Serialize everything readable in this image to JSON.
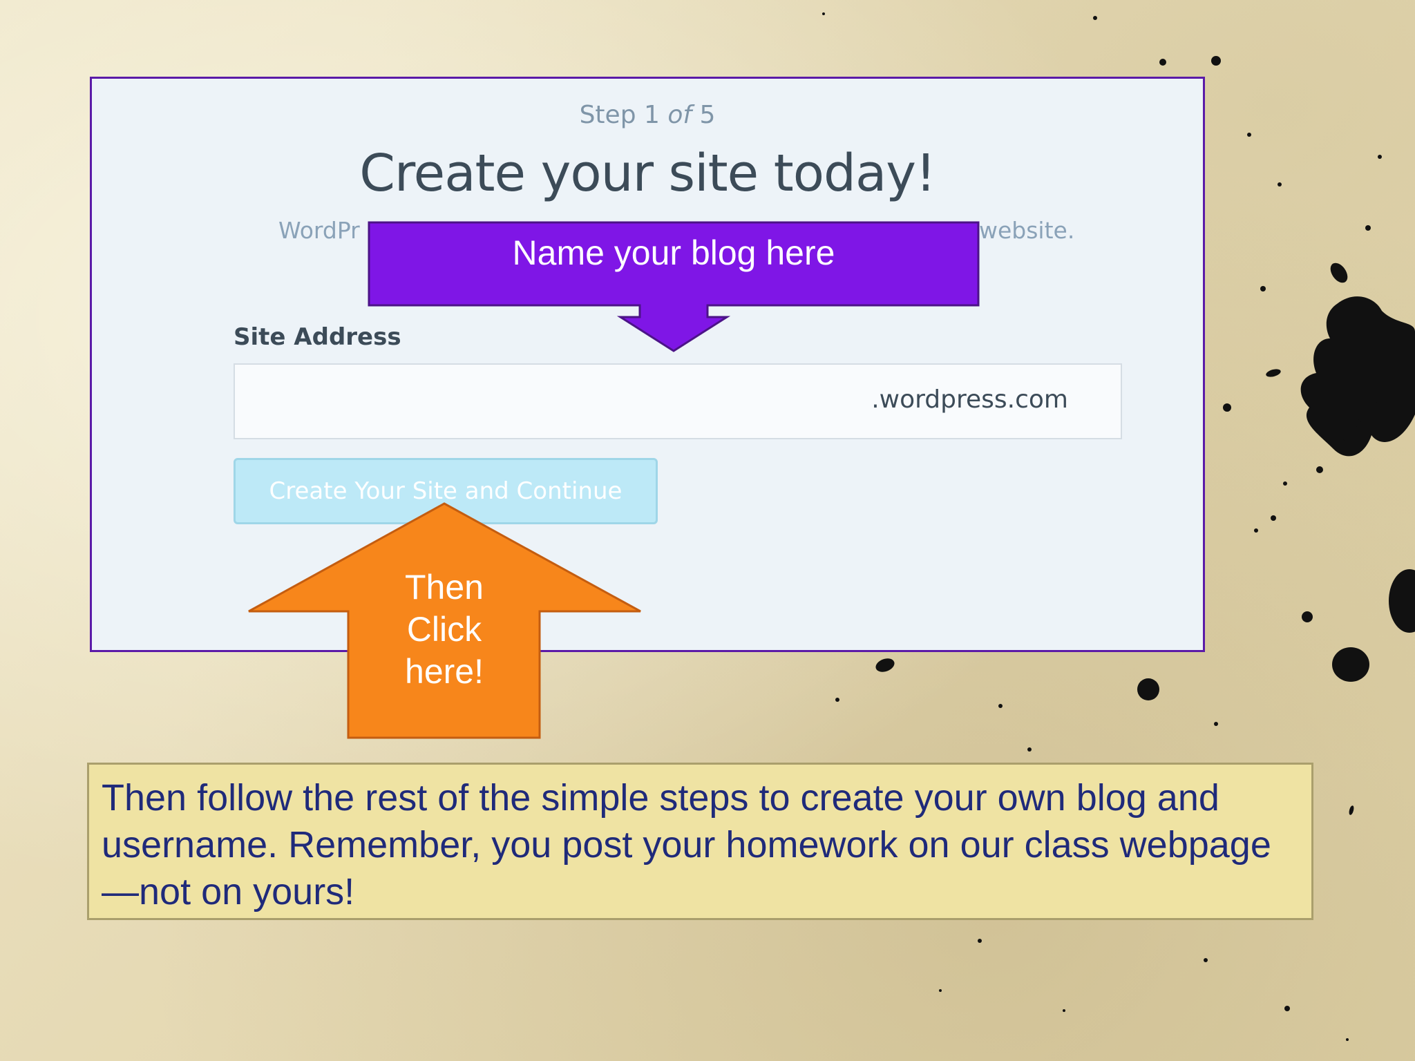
{
  "signup": {
    "step_prefix": "Step 1 ",
    "step_of": "of",
    "step_total": " 5",
    "title": "Create your site today!",
    "subtitle_left": "WordPr",
    "subtitle_right": "website.",
    "site_address_label": "Site Address",
    "address_suffix": ".wordpress.com",
    "create_button_label": "Create Your Site and Continue"
  },
  "annotations": {
    "name_blog": "Name your blog here",
    "click_line1": "Then",
    "click_line2": "Click",
    "click_line3": "here!"
  },
  "note": {
    "text": "Then follow the rest of the simple steps to create your own blog and username. Remember, you post your homework on our class webpage—not on yours!"
  },
  "colors": {
    "panel_border": "#5b1aa8",
    "purple_callout": "#7f16e6",
    "orange_callout": "#f7861b",
    "note_background": "#efe3a3",
    "note_text": "#1f2a7a"
  }
}
